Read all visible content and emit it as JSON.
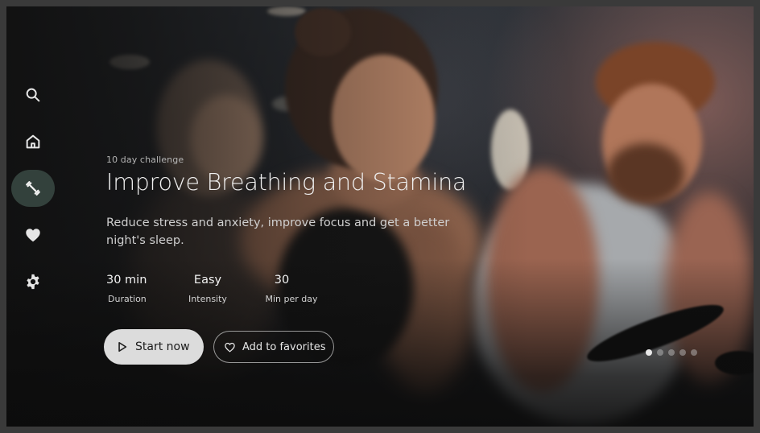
{
  "sidebar": {
    "items": [
      {
        "id": "search",
        "icon": "search-icon",
        "active": false
      },
      {
        "id": "home",
        "icon": "home-icon",
        "active": false
      },
      {
        "id": "workouts",
        "icon": "dumbbell-icon",
        "active": true
      },
      {
        "id": "favorites",
        "icon": "heart-icon",
        "active": false
      },
      {
        "id": "settings",
        "icon": "gear-icon",
        "active": false
      }
    ]
  },
  "hero": {
    "kicker": "10 day challenge",
    "title": "Improve Breathing and Stamina",
    "description": "Reduce stress and anxiety, improve focus and get a better night's sleep.",
    "stats": [
      {
        "value": "30 min",
        "label": "Duration"
      },
      {
        "value": "Easy",
        "label": "Intensity"
      },
      {
        "value": "30",
        "label": "Min per day"
      }
    ],
    "primary_button": {
      "label": "Start now",
      "icon": "play-icon"
    },
    "secondary_button": {
      "label": "Add to favorites",
      "icon": "heart-outline-icon"
    }
  },
  "carousel": {
    "total": 5,
    "active_index": 0
  },
  "colors": {
    "primary_button_bg": "#dcdcdc",
    "active_nav_bg": "#3a4a44",
    "text_primary": "#f0f0f0"
  }
}
